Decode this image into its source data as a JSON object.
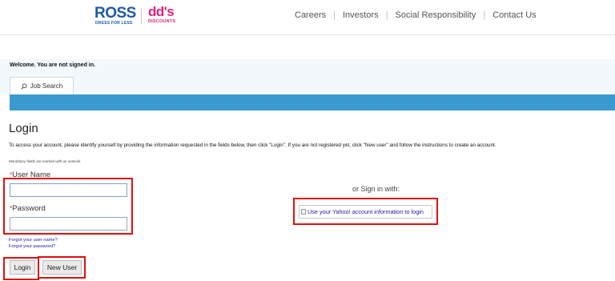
{
  "header": {
    "ross_logo": "ROSS",
    "ross_tagline": "DRESS FOR LESS",
    "dds_logo": "dd's",
    "dds_tagline": "DISCOUNTS",
    "nav": [
      "Careers",
      "Investors",
      "Social Responsibility",
      "Contact Us"
    ]
  },
  "welcome": {
    "text": "Welcome. You are not signed in.",
    "tab_label": "Job Search",
    "tab_icon": "search-icon"
  },
  "login": {
    "title": "Login",
    "instructions": "To access your account, please identify yourself by providing the information requested in the fields below, then click \"Login\". If you are not registered yet, click \"New user\" and follow the instructions to create an account.",
    "mandatory_note": "Mandatory fields are marked with an asterisk.",
    "required_mark": "*",
    "username_label": "User Name",
    "username_value": "",
    "password_label": "Password",
    "password_value": "",
    "forgot_username": "Forgot your user name?",
    "forgot_password": "Forgot your password?",
    "login_button": "Login",
    "new_user_button": "New User"
  },
  "alt_signin": {
    "label": "or Sign in with:",
    "yahoo_alt": "Use your Yahoo! account information to login"
  },
  "colors": {
    "blue_bar": "#3a99cf",
    "highlight_red": "#e01010",
    "link": "#1a1aa8"
  }
}
